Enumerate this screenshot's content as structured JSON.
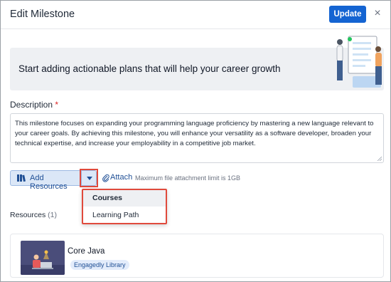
{
  "dialog": {
    "title": "Edit Milestone",
    "update_label": "Update",
    "close_glyph": "×"
  },
  "banner": {
    "text": "Start adding actionable plans that will help your career growth",
    "illustration": "career-planning-illustration"
  },
  "description": {
    "label": "Description",
    "required_mark": "*",
    "value": "This milestone focuses on expanding your programming language proficiency by mastering a new language relevant to your career goals. By achieving this milestone, you will enhance your versatility as a software developer, broaden your technical expertise, and increase your employability in a competitive job market."
  },
  "toolbar": {
    "add_resources_label": "Add Resources",
    "attach_label": "Attach",
    "attach_hint": "Maximum file attachment limit is 1GB"
  },
  "menu": {
    "items": [
      {
        "label": "Courses",
        "highlighted": true
      },
      {
        "label": "Learning Path",
        "highlighted": false
      }
    ]
  },
  "resources": {
    "label": "Resources",
    "count": "(1)",
    "items": [
      {
        "title": "Core Java",
        "badge": "Engagedly Library"
      }
    ]
  },
  "colors": {
    "primary": "#1464d2",
    "highlight": "#e04a3c",
    "required": "#dc2626"
  }
}
